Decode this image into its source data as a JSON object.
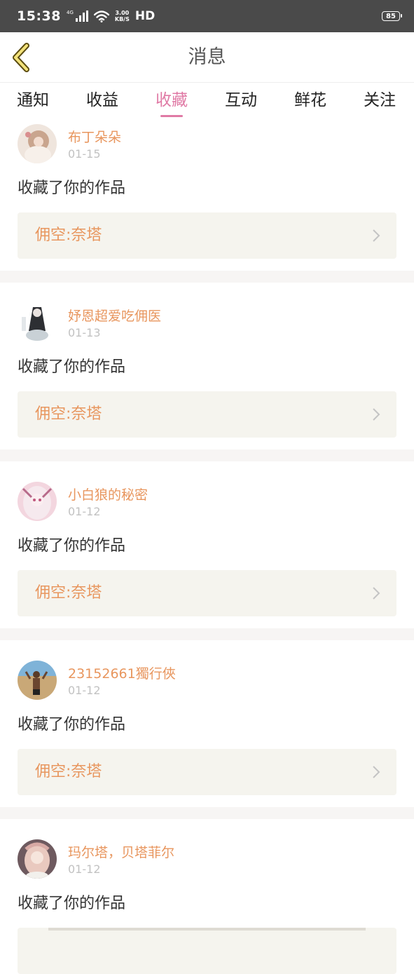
{
  "status_bar": {
    "time": "15:38",
    "network": "4G",
    "speed_value": "3.00",
    "speed_unit": "KB/S",
    "hd": "HD",
    "battery": "85"
  },
  "header": {
    "title": "消息"
  },
  "tabs": [
    {
      "label": "通知"
    },
    {
      "label": "收益"
    },
    {
      "label": "收藏",
      "active": true
    },
    {
      "label": "互动"
    },
    {
      "label": "鲜花"
    },
    {
      "label": "关注"
    }
  ],
  "notifications": [
    {
      "user": "布丁朵朵",
      "date": "01-15",
      "action": "收藏了你的作品",
      "work": "佣空:奈塔"
    },
    {
      "user": "妤恩超爱吃佣医",
      "date": "01-13",
      "action": "收藏了你的作品",
      "work": "佣空:奈塔"
    },
    {
      "user": "小白狼的秘密",
      "date": "01-12",
      "action": "收藏了你的作品",
      "work": "佣空:奈塔"
    },
    {
      "user": "23152661獨行俠",
      "date": "01-12",
      "action": "收藏了你的作品",
      "work": "佣空:奈塔"
    },
    {
      "user": "玛尔塔，贝塔菲尔",
      "date": "01-12",
      "action": "收藏了你的作品",
      "work": ""
    }
  ],
  "colors": {
    "accent_pink": "#e07aa5",
    "username_orange": "#e8965e",
    "work_box_bg": "#f5f4ee",
    "separator": "#f7f5f4",
    "status_bar": "#4a4a4a"
  }
}
